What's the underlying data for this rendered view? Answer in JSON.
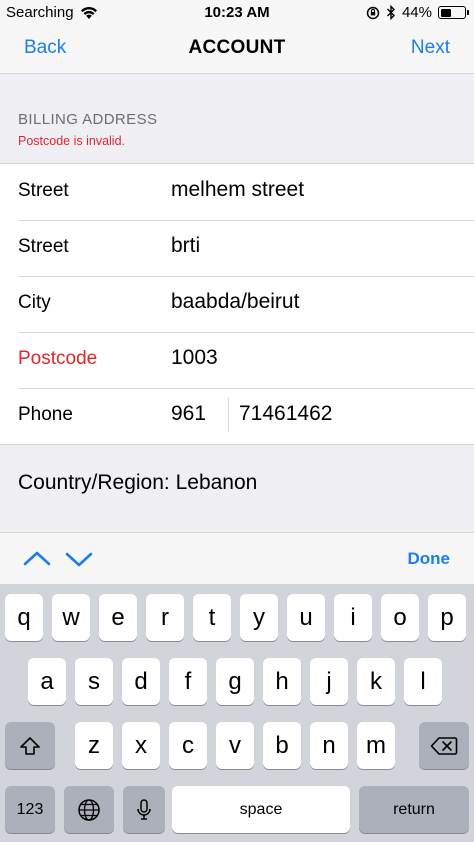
{
  "status_bar": {
    "carrier": "Searching",
    "time": "10:23 AM",
    "battery": "44%",
    "battery_level": 0.44
  },
  "nav": {
    "back": "Back",
    "title": "ACCOUNT",
    "next": "Next"
  },
  "section": {
    "title": "BILLING ADDRESS",
    "error": "Postcode is invalid."
  },
  "form": {
    "rows": [
      {
        "label": "Street",
        "value": "melhem street"
      },
      {
        "label": "Street",
        "value": "brti"
      },
      {
        "label": "City",
        "value": "baabda/beirut"
      },
      {
        "label": "Postcode",
        "value": "1003"
      }
    ],
    "phone": {
      "label": "Phone",
      "code": "961",
      "number": "71461462"
    }
  },
  "country": "Country/Region: Lebanon",
  "toolbar": {
    "done": "Done"
  },
  "keyboard": {
    "row1": [
      "q",
      "w",
      "e",
      "r",
      "t",
      "y",
      "u",
      "i",
      "o",
      "p"
    ],
    "row2": [
      "a",
      "s",
      "d",
      "f",
      "g",
      "h",
      "j",
      "k",
      "l"
    ],
    "row3": [
      "z",
      "x",
      "c",
      "v",
      "b",
      "n",
      "m"
    ],
    "numbers": "123",
    "space": "space",
    "return": "return"
  },
  "colors": {
    "accent": "#1a7ef0",
    "error": "#e0262b"
  }
}
